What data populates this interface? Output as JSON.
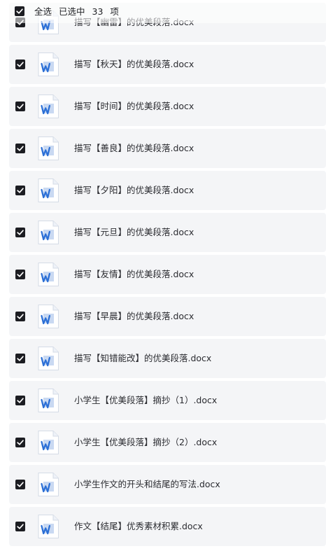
{
  "header": {
    "select_all_label": "全选",
    "selected_prefix": "已选中",
    "selected_count": "33",
    "selected_suffix": "项"
  },
  "files": [
    {
      "name": "描写【幽雷】的优美段落.docx",
      "checked": true
    },
    {
      "name": "描写【秋天】的优美段落.docx",
      "checked": true
    },
    {
      "name": "描写【时间】的优美段落.docx",
      "checked": true
    },
    {
      "name": "描写【善良】的优美段落.docx",
      "checked": true
    },
    {
      "name": "描写【夕阳】的优美段落.docx",
      "checked": true
    },
    {
      "name": "描写【元旦】的优美段落.docx",
      "checked": true
    },
    {
      "name": "描写【友情】的优美段落.docx",
      "checked": true
    },
    {
      "name": "描写【早晨】的优美段落.docx",
      "checked": true
    },
    {
      "name": "描写【知错能改】的优美段落.docx",
      "checked": true
    },
    {
      "name": "小学生【优美段落】摘抄（1）.docx",
      "checked": true
    },
    {
      "name": "小学生【优美段落】摘抄（2）.docx",
      "checked": true
    },
    {
      "name": "小学生作文的开头和结尾的写法.docx",
      "checked": true
    },
    {
      "name": "作文【结尾】优秀素材积累.docx",
      "checked": true
    }
  ],
  "icons": {
    "checkbox": "checkbox-checked-icon",
    "file": "word-file-icon"
  },
  "colors": {
    "row_bg": "#f4f5f7",
    "checkbox_fill": "#1c1d22",
    "word_blue": "#2b6fd6"
  }
}
